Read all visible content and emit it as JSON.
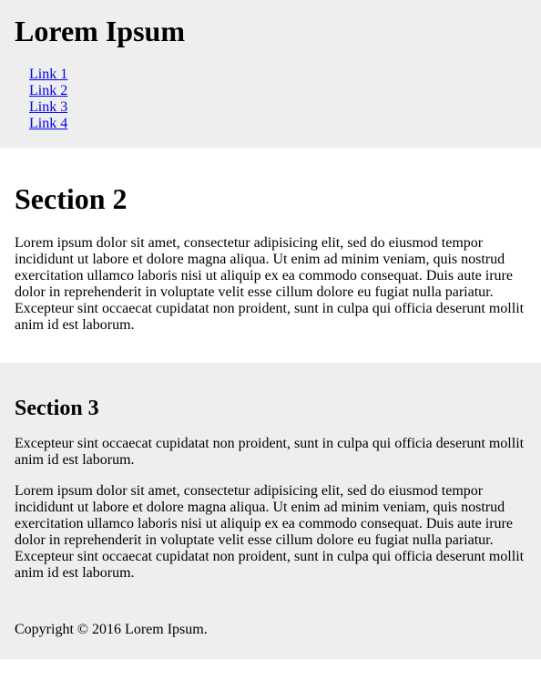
{
  "header": {
    "title": "Lorem Ipsum",
    "links": [
      "Link 1",
      "Link 2",
      "Link 3",
      "Link 4"
    ]
  },
  "section2": {
    "title": "Section 2",
    "paragraph": "Lorem ipsum dolor sit amet, consectetur adipisicing elit, sed do eiusmod tempor incididunt ut labore et dolore magna aliqua. Ut enim ad minim veniam, quis nostrud exercitation ullamco laboris nisi ut aliquip ex ea commodo consequat. Duis aute irure dolor in reprehenderit in voluptate velit esse cillum dolore eu fugiat nulla pariatur. Excepteur sint occaecat cupidatat non proident, sunt in culpa qui officia deserunt mollit anim id est laborum."
  },
  "section3": {
    "title": "Section 3",
    "paragraph1": "Excepteur sint occaecat cupidatat non proident, sunt in culpa qui officia deserunt mollit anim id est laborum.",
    "paragraph2": "Lorem ipsum dolor sit amet, consectetur adipisicing elit, sed do eiusmod tempor incididunt ut labore et dolore magna aliqua. Ut enim ad minim veniam, quis nostrud exercitation ullamco laboris nisi ut aliquip ex ea commodo consequat. Duis aute irure dolor in reprehenderit in voluptate velit esse cillum dolore eu fugiat nulla pariatur. Excepteur sint occaecat cupidatat non proident, sunt in culpa qui officia deserunt mollit anim id est laborum."
  },
  "footer": {
    "copyright": "Copyright © 2016 Lorem Ipsum."
  },
  "colors": {
    "band_gray": "#eeeeee",
    "link": "#0000ee",
    "text": "#000000"
  }
}
